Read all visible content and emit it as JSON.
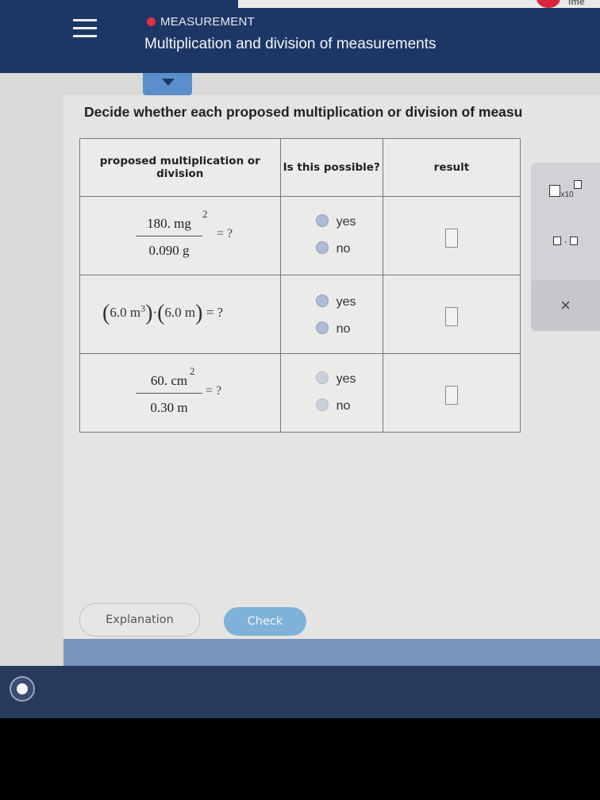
{
  "header": {
    "section": "MEASUREMENT",
    "title": "Multiplication and division of measurements"
  },
  "instruction": "Decide whether each proposed multiplication or division of measu",
  "table": {
    "headers": [
      "proposed multiplication or division",
      "Is this possible?",
      "result"
    ],
    "rows": [
      {
        "numerator": "180. mg",
        "numerator_exp": "2",
        "denominator": "0.090 g",
        "equals": "= ?",
        "options": [
          "yes",
          "no"
        ]
      },
      {
        "expr_a": "6.0 m",
        "expr_a_exp": "3",
        "dot": "·",
        "expr_b": "6.0 m",
        "equals": "= ?",
        "options": [
          "yes",
          "no"
        ]
      },
      {
        "numerator": "60. cm",
        "numerator_exp": "2",
        "denominator": "0.30 m",
        "equals": "= ?",
        "options": [
          "yes",
          "no"
        ]
      }
    ]
  },
  "sidebar": {
    "sci_label": "x10",
    "close_symbol": "×"
  },
  "buttons": {
    "explanation": "Explanation",
    "check": "Check"
  },
  "brand": {
    "topstrip_text": "ime"
  }
}
